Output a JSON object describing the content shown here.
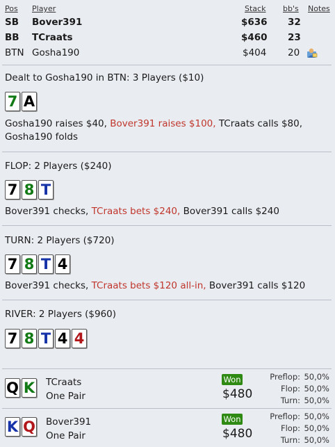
{
  "header": {
    "pos": "Pos",
    "player": "Player",
    "stack": "Stack",
    "bbs": "bb's",
    "notes": "Notes"
  },
  "players": [
    {
      "pos": "SB",
      "name": "Bover391",
      "stack": "$636",
      "bbs": "32"
    },
    {
      "pos": "BB",
      "name": "TCraats",
      "stack": "$460",
      "bbs": "23"
    },
    {
      "pos": "BTN",
      "name": "Gosha190",
      "stack": "$404",
      "bbs": "20",
      "note_icon": "note-person-icon"
    }
  ],
  "preflop": {
    "title": "Dealt to Gosha190 in BTN: 3 Players ($10)",
    "cards": [
      {
        "rank": "7",
        "color": "#127a15"
      },
      {
        "rank": "A",
        "color": "#000"
      }
    ],
    "actions_1": "Gosha190 raises $40, ",
    "actions_2": "Bover391 raises $100,",
    "actions_3": " TCraats calls $80,",
    "actions_4": "Gosha190 folds"
  },
  "flop": {
    "title": "FLOP: 2 Players ($240)",
    "cards": [
      {
        "rank": "7",
        "color": "#000"
      },
      {
        "rank": "8",
        "color": "#127a15"
      },
      {
        "rank": "T",
        "color": "#1733a8"
      }
    ],
    "actions_1": "Bover391 checks, ",
    "actions_2": "TCraats bets $240,",
    "actions_3": " Bover391 calls $240"
  },
  "turn": {
    "title": "TURN: 2 Players ($720)",
    "cards": [
      {
        "rank": "7",
        "color": "#000"
      },
      {
        "rank": "8",
        "color": "#127a15"
      },
      {
        "rank": "T",
        "color": "#1733a8"
      },
      {
        "rank": "4",
        "color": "#000"
      }
    ],
    "actions_1": "Bover391 checks, ",
    "actions_2": "TCraats bets $120 all-in,",
    "actions_3": " Bover391 calls $120"
  },
  "river": {
    "title": "RIVER: 2 Players ($960)",
    "cards": [
      {
        "rank": "7",
        "color": "#000"
      },
      {
        "rank": "8",
        "color": "#127a15"
      },
      {
        "rank": "T",
        "color": "#1733a8"
      },
      {
        "rank": "4",
        "color": "#000"
      },
      {
        "rank": "4",
        "color": "#b0161a"
      }
    ]
  },
  "showdown": [
    {
      "name": "TCraats",
      "hand": "One Pair",
      "won": "Won",
      "amount": "$480",
      "cards": [
        {
          "rank": "Q",
          "color": "#000"
        },
        {
          "rank": "K",
          "color": "#127a15"
        }
      ],
      "equity": [
        {
          "label": "Preflop:",
          "value": "50,0%"
        },
        {
          "label": "Flop:",
          "value": "50,0%"
        },
        {
          "label": "Turn:",
          "value": "50,0%"
        }
      ]
    },
    {
      "name": "Bover391",
      "hand": "One Pair",
      "won": "Won",
      "amount": "$480",
      "cards": [
        {
          "rank": "K",
          "color": "#1733a8"
        },
        {
          "rank": "Q",
          "color": "#b0161a"
        }
      ],
      "equity": [
        {
          "label": "Preflop:",
          "value": "50,0%"
        },
        {
          "label": "Flop:",
          "value": "50,0%"
        },
        {
          "label": "Turn:",
          "value": "50,0%"
        }
      ]
    }
  ]
}
